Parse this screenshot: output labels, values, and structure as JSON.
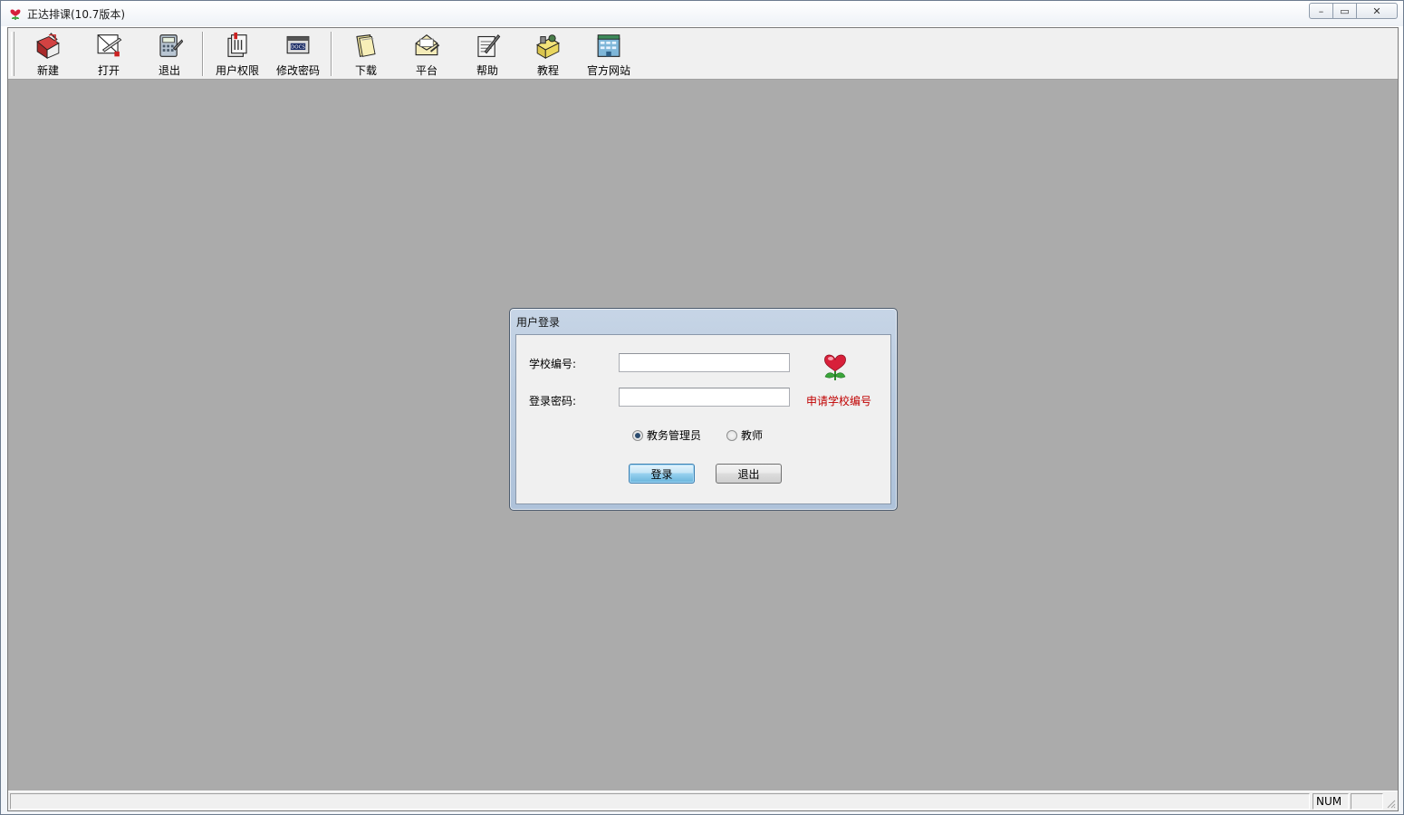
{
  "window": {
    "title": "正达排课(10.7版本)",
    "controls": {
      "minimize": "–",
      "restore": "▭",
      "close": "✕"
    }
  },
  "toolbar": {
    "items": [
      {
        "label": "新建",
        "icon": "new-doc-icon"
      },
      {
        "label": "打开",
        "icon": "open-icon"
      },
      {
        "label": "退出",
        "icon": "exit-calculator-icon"
      },
      {
        "label": "用户权限",
        "icon": "user-permission-icon"
      },
      {
        "label": "修改密码",
        "icon": "change-password-icon"
      },
      {
        "label": "下载",
        "icon": "download-folder-icon"
      },
      {
        "label": "平台",
        "icon": "platform-envelope-icon"
      },
      {
        "label": "帮助",
        "icon": "help-book-icon"
      },
      {
        "label": "教程",
        "icon": "tutorial-icon"
      },
      {
        "label": "官方网站",
        "icon": "website-building-icon"
      }
    ]
  },
  "dialog": {
    "title": "用户登录",
    "school_id_label": "学校编号:",
    "school_id_value": "",
    "password_label": "登录密码:",
    "password_value": "",
    "apply_link": "申请学校编号",
    "role_admin": "教务管理员",
    "role_teacher": "教师",
    "selected_role": "admin",
    "login_button": "登录",
    "exit_button": "退出"
  },
  "statusbar": {
    "main": "",
    "num": "NUM"
  }
}
